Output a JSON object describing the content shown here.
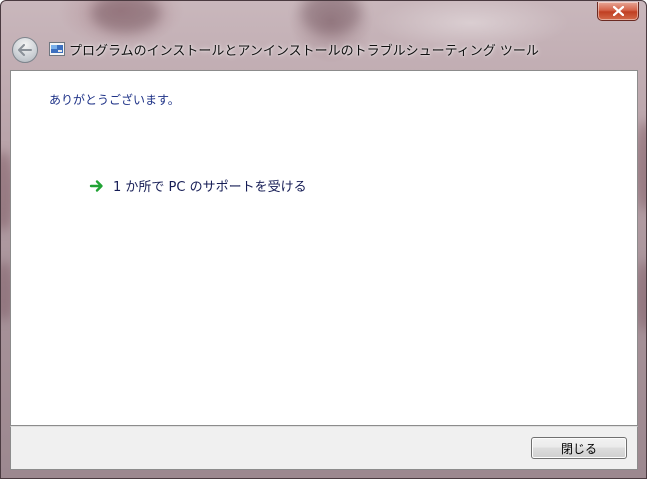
{
  "window": {
    "title": "プログラムのインストールとアンインストールのトラブルシューティング ツール"
  },
  "content": {
    "thanks": "ありがとうございます。",
    "help_link": "1 か所で PC のサポートを受ける"
  },
  "footer": {
    "close_label": "閉じる"
  },
  "icons": {
    "close": "close-icon",
    "back": "back-arrow-icon",
    "app": "troubleshooter-app-icon",
    "link": "green-arrow-icon"
  },
  "colors": {
    "heading_text": "#1e3287",
    "link_text": "#151c55",
    "link_arrow": "#21a335",
    "close_button": "#c03f22"
  }
}
